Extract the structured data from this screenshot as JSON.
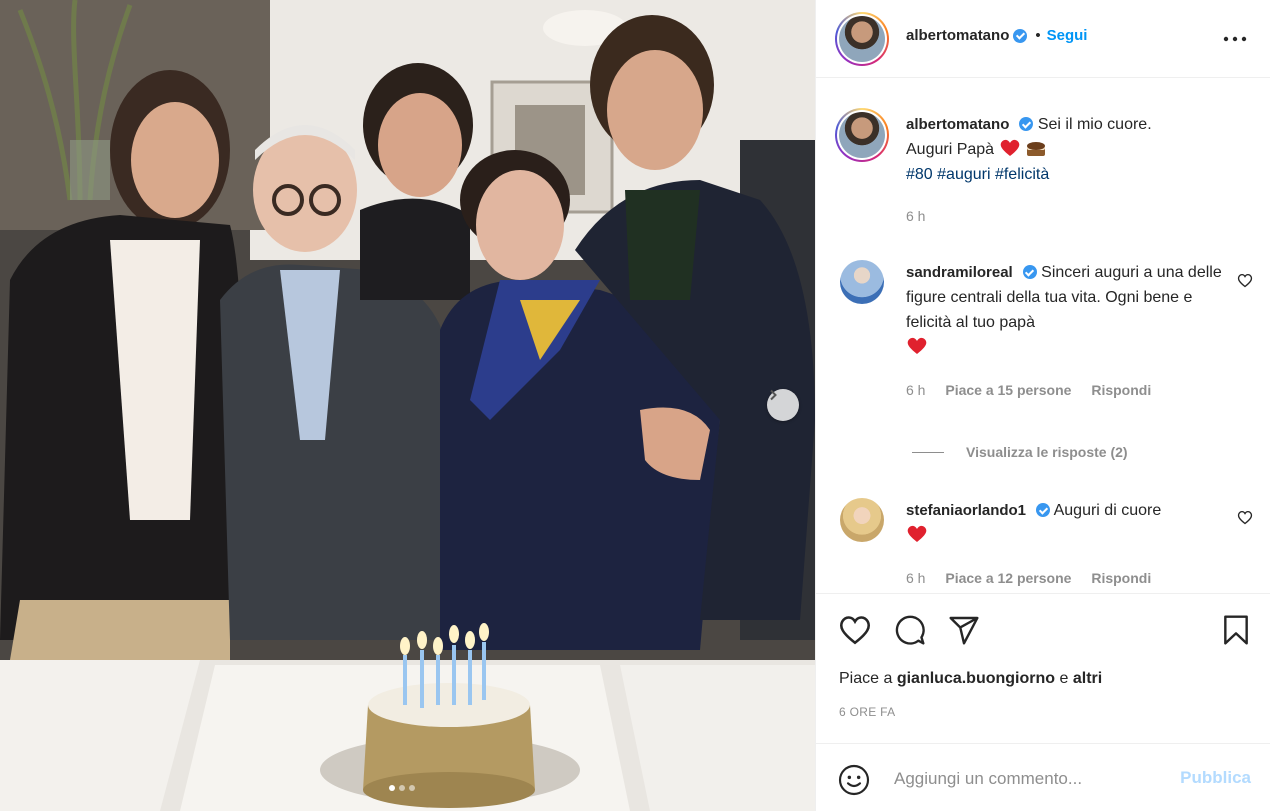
{
  "post": {
    "author": "albertomatano",
    "follow_label": "Segui",
    "separator": "•",
    "caption_line1": "Sei il mio cuore.",
    "caption_line2": "Auguri Papà",
    "hashtags": "#80 #auguri #felicità",
    "caption_time": "6 h",
    "likes_prefix": "Piace a",
    "likes_user": "gianluca.buongiorno",
    "likes_and": "e",
    "likes_others": "altri",
    "time_ago": "6 ORE FA",
    "carousel_count": 3,
    "carousel_active": 0
  },
  "comments": [
    {
      "user": "sandramiloreal",
      "text": "Sinceri auguri a una delle figure centrali della tua vita. Ogni bene e felicità al tuo papà",
      "time": "6 h",
      "likes": "Piace a 15 persone",
      "reply": "Rispondi"
    },
    {
      "user": "stefaniaorlando1",
      "text": "Auguri di cuore",
      "time": "6 h",
      "likes": "Piace a 12 persone",
      "reply": "Rispondi"
    }
  ],
  "view_replies": "Visualizza le risposte (2)",
  "comment_box": {
    "placeholder": "Aggiungi un commento...",
    "publish": "Pubblica"
  },
  "colors": {
    "follow": "#0095f6",
    "verified": "#3897f0",
    "hashtag": "#00376b",
    "muted": "#8e8e8e",
    "heart": "#ed4956",
    "publish_disabled": "#b3dbff"
  },
  "icons": [
    "verified-icon",
    "more-options-icon",
    "heart-icon",
    "comment-icon",
    "share-icon",
    "bookmark-icon",
    "emoji-icon",
    "chevron-right-icon"
  ]
}
